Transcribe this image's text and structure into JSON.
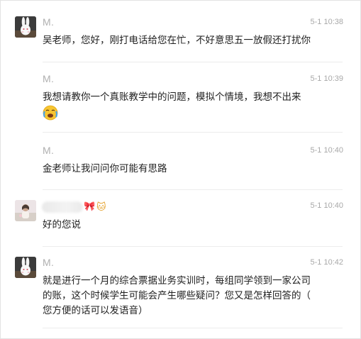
{
  "colors": {
    "name": "#b0b0b0",
    "time": "#a8a8a8",
    "text": "#1f1f1f",
    "divider": "#ececec"
  },
  "messages": [
    {
      "sender": "M.",
      "time": "5-1 10:38",
      "avatar": "rabbit-avatar",
      "lines": [
        "吴老师，您好，刚打电话给您在忙，不好意思五一放假还打扰你"
      ]
    },
    {
      "sender": "M.",
      "time": "5-1 10:39",
      "lines": [
        "我想请教你一个真账教学中的问题，模拟个情境，我想不出来"
      ],
      "emoji": "crying-face-emoji"
    },
    {
      "sender": "M.",
      "time": "5-1 10:40",
      "lines": [
        "金老师让我问问你可能有思路"
      ]
    },
    {
      "sender_blurred": true,
      "sender_decorations": [
        "bow-icon",
        "cat-icon"
      ],
      "time": "5-1 10:40",
      "avatar": "photo-avatar",
      "lines": [
        "好的您说"
      ]
    },
    {
      "sender": "M.",
      "time": "5-1 10:42",
      "avatar": "rabbit-avatar",
      "lines": [
        "就是进行一个月的综合票据业务实训时，每组同学领到一家公司",
        "的账，这个时候学生可能会产生哪些疑问？您又是怎样回答的（",
        "您方便的话可以发语音）"
      ]
    }
  ]
}
